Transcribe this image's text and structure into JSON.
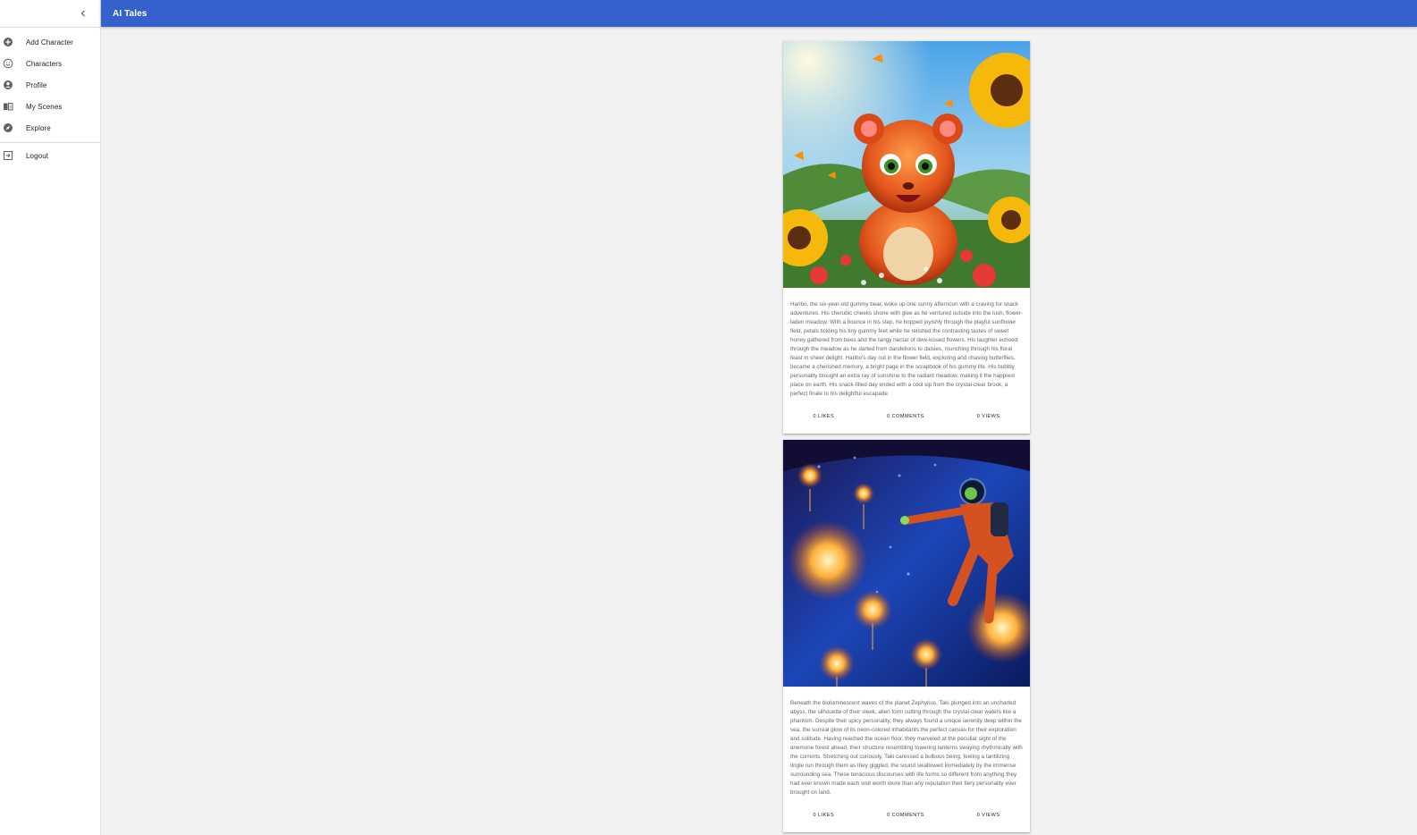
{
  "app": {
    "title": "AI Tales"
  },
  "sidebar": {
    "collapse_icon": "chevron-left-icon",
    "items": [
      {
        "label": "Add Character",
        "icon": "add-circle-icon"
      },
      {
        "label": "Characters",
        "icon": "smiley-face-icon"
      },
      {
        "label": "Profile",
        "icon": "account-circle-icon"
      },
      {
        "label": "My Scenes",
        "icon": "book-icon"
      },
      {
        "label": "Explore",
        "icon": "compass-icon"
      }
    ],
    "logout": {
      "label": "Logout",
      "icon": "logout-icon"
    }
  },
  "feed": {
    "cards": [
      {
        "image": "gummy-bear-sunflower-field-illustration",
        "text": "Haribo, the six-year-old gummy bear, woke up one sunny afternoon with a craving for snack adventures. His cherubic cheeks shone with glee as he ventured outside into the lush, flower-laden meadow. With a bounce in his step, he hopped joyishly through the playful sunflower field, petals tickling his tiny gummy feet while he relished the contrasting tastes of sweet honey gathered from bees and the tangy nectar of dew-kissed flowers. His laughter echoed through the meadow as he darted from dandelions to daisies, munching through his floral feast in sheer delight. Haribo's day out in the flower field, exploring and chasing butterflies, became a cherished memory, a bright page in the scrapbook of his gummy life. His bubbly personality brought an extra ray of sunshine to the radiant meadow, making it the happiest place on earth. His snack-filled day ended with a cool sip from the crystal-clear brook, a perfect finale to his delightful escapade.",
        "likes": "0 LIKES",
        "comments": "0 COMMENTS",
        "views": "0 VIEWS"
      },
      {
        "image": "alien-diver-bioluminescent-sea-illustration",
        "text": "Beneath the bioluminescent waves of the planet Zephyrius, Taki plunged into an uncharted abyss, the silhouette of their sleek, alien form cutting through the crystal-clear waters like a phantom. Despite their spicy personality, they always found a unique serenity deep within the sea, the surreal glow of its neon-colored inhabitants the perfect canvas for their exploration and solitude. Having reached the ocean floor, they marveled at the peculiar sight of the anemone forest ahead, their structure resembling towering lanterns swaying rhythmically with the currents. Stretching out curiously, Taki caressed a bulbous being, feeling a tantilizing tingle run through them as they giggled, the sound swallowed immediately by the immense surrounding sea. These tenacious discourses with life forms so different from anything they had ever known made each visit worth more than any reputation their fiery personality ever brought on land.",
        "likes": "0 LIKES",
        "comments": "0 COMMENTS",
        "views": "0 VIEWS"
      }
    ]
  },
  "colors": {
    "appbar": "#3461cc",
    "background": "#f2f2f2",
    "sidebar": "#ffffff"
  }
}
